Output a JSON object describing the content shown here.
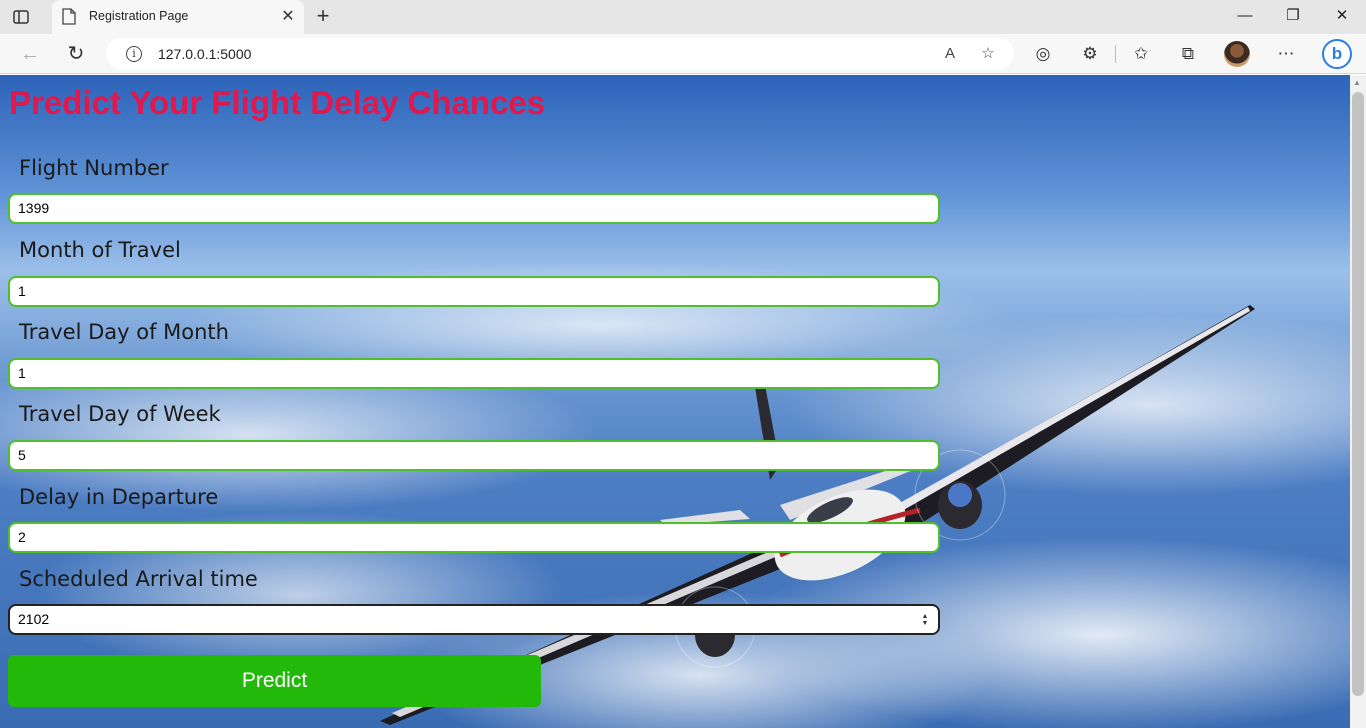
{
  "browser": {
    "tab_title": "Registration Page",
    "url": "127.0.0.1:5000"
  },
  "page": {
    "title": "Predict Your Flight Delay Chances",
    "fields": [
      {
        "label": "Flight Number",
        "value": "1399"
      },
      {
        "label": "Month of Travel",
        "value": "1"
      },
      {
        "label": "Travel Day of Month",
        "value": "1"
      },
      {
        "label": "Travel Day of Week",
        "value": "5"
      },
      {
        "label": "Delay in Departure",
        "value": "2"
      },
      {
        "label": "Scheduled Arrival time",
        "value": "2102"
      }
    ],
    "submit_label": "Predict"
  },
  "colors": {
    "title": "#e3174b",
    "input_border": "#4fbf2a",
    "button": "#22b90a"
  }
}
